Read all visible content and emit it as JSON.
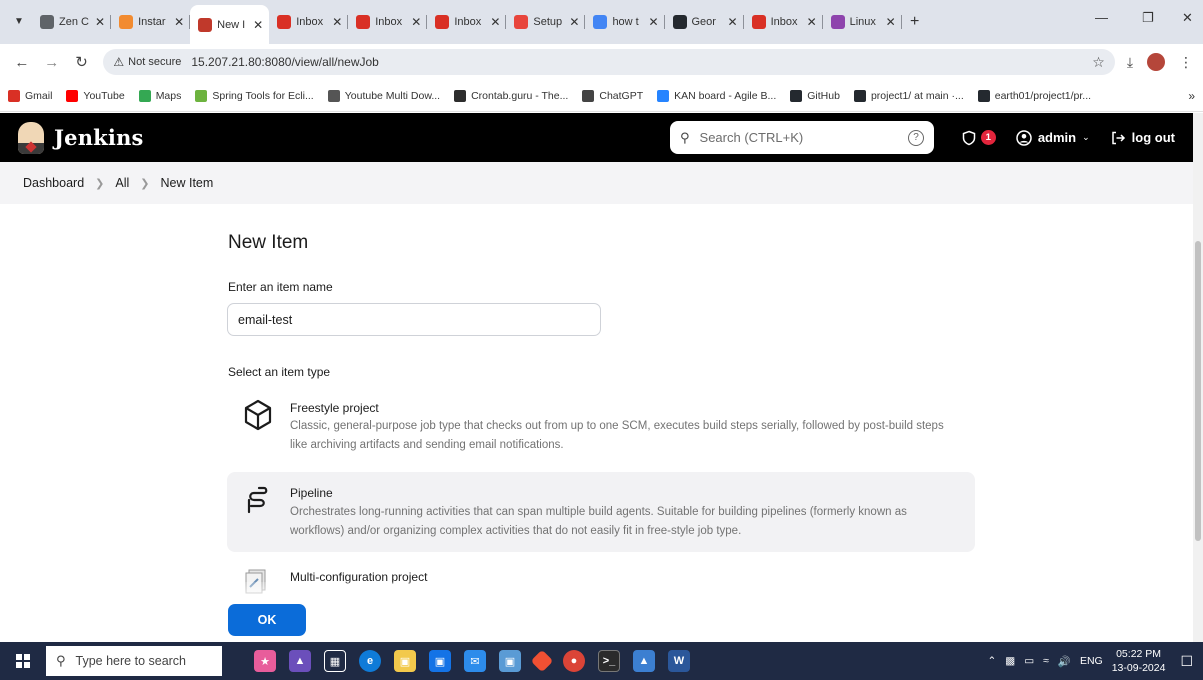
{
  "browser": {
    "tabs": [
      {
        "label": "Zen C",
        "icon": "document-icon",
        "color": "#5f6368"
      },
      {
        "label": "Instar",
        "icon": "instar-icon",
        "color": "#f28b30"
      },
      {
        "label": "New I",
        "icon": "jenkins-icon",
        "color": "#c0392b",
        "active": true
      },
      {
        "label": "Inbox",
        "icon": "gmail-icon",
        "color": "#d93025"
      },
      {
        "label": "Inbox",
        "icon": "gmail-icon",
        "color": "#d93025"
      },
      {
        "label": "Inbox",
        "icon": "gmail-icon",
        "color": "#d93025"
      },
      {
        "label": "Setup",
        "icon": "setup-icon",
        "color": "#e8453c"
      },
      {
        "label": "how t",
        "icon": "google-icon",
        "color": "#4285f4"
      },
      {
        "label": "Geor",
        "icon": "github-icon",
        "color": "#24292f"
      },
      {
        "label": "Inbox",
        "icon": "gmail-icon",
        "color": "#d93025"
      },
      {
        "label": "Linux",
        "icon": "linux-icon",
        "color": "#8e44ad"
      }
    ],
    "address": {
      "security": "Not secure",
      "url": "15.207.21.80:8080/view/all/newJob"
    },
    "bookmarks": [
      {
        "label": "Gmail",
        "icon": "gmail-icon",
        "color": "#d93025"
      },
      {
        "label": "YouTube",
        "icon": "youtube-icon",
        "color": "#ff0000"
      },
      {
        "label": "Maps",
        "icon": "maps-icon",
        "color": "#34a853"
      },
      {
        "label": "Spring Tools for Ecli...",
        "icon": "spring-icon",
        "color": "#6db33f"
      },
      {
        "label": "Youtube Multi Dow...",
        "icon": "globe-icon",
        "color": "#555555"
      },
      {
        "label": "Crontab.guru - The...",
        "icon": "crontab-icon",
        "color": "#2d2d2d"
      },
      {
        "label": "ChatGPT",
        "icon": "chatgpt-icon",
        "color": "#444444"
      },
      {
        "label": "KAN board - Agile B...",
        "icon": "jira-icon",
        "color": "#2684ff"
      },
      {
        "label": "GitHub",
        "icon": "github-icon",
        "color": "#24292f"
      },
      {
        "label": "project1/ at main ·...",
        "icon": "github-icon",
        "color": "#24292f"
      },
      {
        "label": "earth01/project1/pr...",
        "icon": "github-icon",
        "color": "#24292f"
      }
    ]
  },
  "jenkins": {
    "title": "Jenkins",
    "search_placeholder": "Search (CTRL+K)",
    "alerts_count": "1",
    "user": "admin",
    "logout": "log out",
    "breadcrumb": [
      "Dashboard",
      "All",
      "New Item"
    ],
    "page_title": "New Item",
    "name_label": "Enter an item name",
    "name_value": "email-test",
    "type_label": "Select an item type",
    "items": [
      {
        "title": "Freestyle project",
        "desc": "Classic, general-purpose job type that checks out from up to one SCM, executes build steps serially, followed by post-build steps like archiving artifacts and sending email notifications."
      },
      {
        "title": "Pipeline",
        "desc": "Orchestrates long-running activities that can span multiple build agents. Suitable for building pipelines (formerly known as workflows) and/or organizing complex activities that do not easily fit in free-style job type."
      },
      {
        "title": "Multi-configuration project",
        "desc": ""
      }
    ],
    "ok": "OK",
    "accent": "#0b6cd9"
  },
  "taskbar": {
    "search_placeholder": "Type here to search",
    "language": "ENG",
    "time": "05:22 PM",
    "date": "13-09-2024"
  }
}
